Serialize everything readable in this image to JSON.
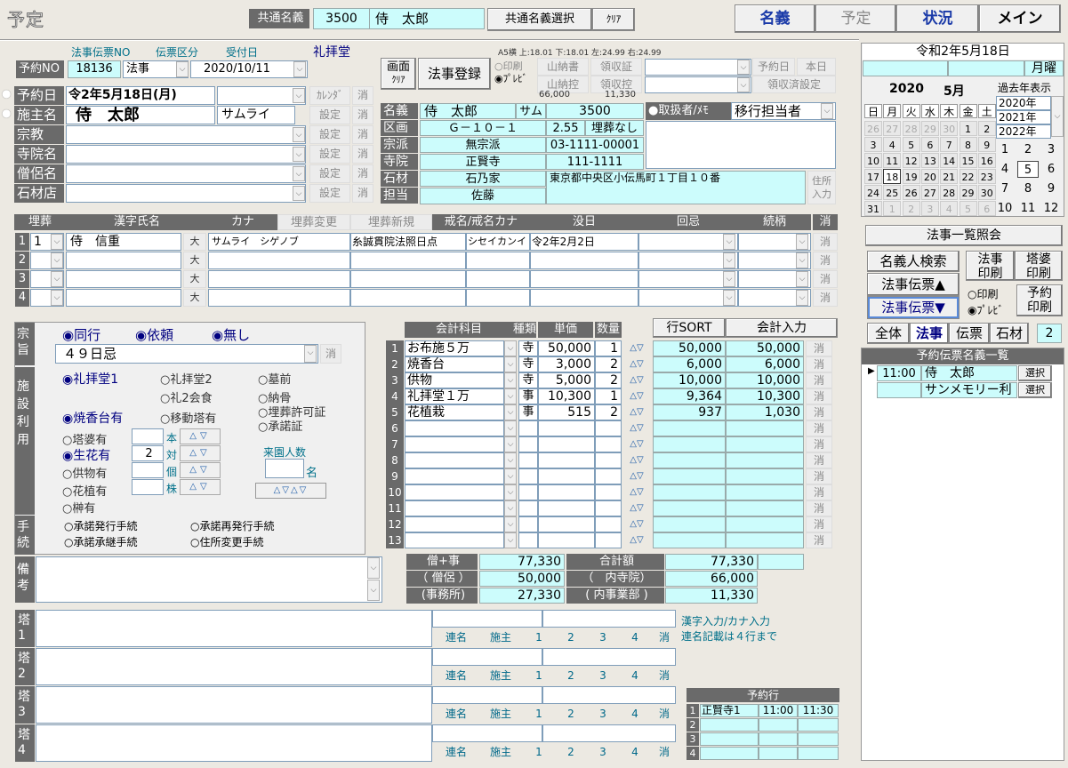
{
  "window": {
    "title": "予定"
  },
  "top": {
    "common_label": "共通名義",
    "common_no": "3500",
    "common_name": "侍　太郎",
    "select_button": "共通名義選択",
    "clear_button": "ｸﾘｱ",
    "tabs": [
      "名義",
      "予定",
      "状況",
      "メイン"
    ]
  },
  "slip": {
    "header_no": "法事伝票NO",
    "header_kubun": "伝票区分",
    "header_date": "受付日",
    "venue": "礼拝堂",
    "label": "予約NO",
    "no": "18136",
    "kubun": "法事",
    "date": "2020/10/11"
  },
  "actions": {
    "screen_clear_1": "画面",
    "screen_clear_2": "ｸﾘｱ",
    "register": "法事登録",
    "print": "印刷",
    "preview": "ﾌﾟﾚﾋﾞ",
    "paper": "A5横 上:18.01 下:18.01 左:24.99 右:24.99",
    "yama_shu": "山納書",
    "yama_hikae": "山納控",
    "ryoshu": "領収証",
    "ryoshu_hikae": "領収控",
    "yoyakubi": "予約日",
    "honjitsu": "本日",
    "ryoshu_settei": "領収済設定",
    "amount_a": "66,000",
    "amount_b": "11,330"
  },
  "form": {
    "rows": [
      {
        "label": "予約日",
        "value": "令2年5月18日(月)",
        "btn": "ｶﾚﾝﾀﾞ"
      },
      {
        "label": "施主名",
        "value": "侍　太郎",
        "kana": "サムライ",
        "btn": "設定"
      },
      {
        "label": "宗教",
        "value": "",
        "btn": "設定"
      },
      {
        "label": "寺院名",
        "value": "",
        "btn": "設定"
      },
      {
        "label": "僧侶名",
        "value": "",
        "btn": "設定"
      },
      {
        "label": "石材店",
        "value": "",
        "btn": "設定"
      }
    ],
    "clear": "消"
  },
  "info": {
    "labels": [
      "名義",
      "区画",
      "宗派",
      "寺院",
      "石材",
      "担当"
    ],
    "name": "侍　太郎",
    "sam": "サム",
    "no": "3500",
    "kukaku": "Ｇ－１０－１",
    "size": "2.55",
    "maiso": "埋葬なし",
    "shuha": "無宗派",
    "phone": "03-1111-00001",
    "jiin": "正賢寺",
    "zip": "111-1111",
    "sekizai": "石乃家",
    "address": "東京都中央区小伝馬町１丁目１０番",
    "tanto": "佐藤",
    "handler": "取扱者/ﾒﾓ",
    "handler_value": "移行担当者",
    "addr_btn_1": "住所",
    "addr_btn_2": "入力"
  },
  "burial": {
    "headers": [
      "埋葬",
      "漢字氏名",
      "カナ",
      "埋葬変更",
      "埋葬新規",
      "戒名/戒名カナ",
      "没日",
      "回忌",
      "続柄",
      "消"
    ],
    "rows": [
      {
        "no": "1",
        "sel": "1",
        "name": "侍　信重",
        "kana": "サムライ　シゲノブ",
        "kaimyo": "糸誠貫院法照日点",
        "kaimyo_kana": "シセイカンイ",
        "botsu": "令2年2月2日"
      },
      {
        "no": "2"
      },
      {
        "no": "3"
      },
      {
        "no": "4"
      }
    ],
    "dai": "大",
    "clear": "消"
  },
  "options": {
    "shushi": "宗旨",
    "shisetsu": "施設利用",
    "tetsuzuki": "手続",
    "doko": "同行",
    "irai": "依頼",
    "nashi": "無し",
    "kaiki": "４９日忌",
    "facilities": [
      "礼拝堂1",
      "礼拝堂2",
      "墓前",
      "礼2会食",
      "納骨",
      "埋葬許可証",
      "承諾証",
      "焼香台有",
      "移動塔有",
      "塔婆有",
      "生花有",
      "供物有",
      "花植有",
      "榊有"
    ],
    "unit_labels": [
      "本",
      "対",
      "個",
      "株"
    ],
    "flower_count": "2",
    "raien": "来園人数",
    "mei": "名",
    "procedures": [
      "承諾発行手続",
      "承諾再発行手続",
      "承諾承継手続",
      "住所変更手続"
    ],
    "biko": "備考"
  },
  "accounts": {
    "headers": [
      "会計科目",
      "種類",
      "単価",
      "数量"
    ],
    "gyo_sort": "行SORT",
    "input": "会計入力",
    "rows": [
      {
        "no": "1",
        "item": "お布施５万",
        "kind": "寺",
        "price": "50,000",
        "qty": "1",
        "a": "50,000",
        "b": "50,000"
      },
      {
        "no": "2",
        "item": "焼香台",
        "kind": "寺",
        "price": "3,000",
        "qty": "2",
        "a": "6,000",
        "b": "6,000"
      },
      {
        "no": "3",
        "item": "供物",
        "kind": "寺",
        "price": "5,000",
        "qty": "2",
        "a": "10,000",
        "b": "10,000"
      },
      {
        "no": "4",
        "item": "礼拝堂１万",
        "kind": "事",
        "price": "10,300",
        "qty": "1",
        "a": "9,364",
        "b": "10,300"
      },
      {
        "no": "5",
        "item": "花植栽",
        "kind": "事",
        "price": "515",
        "qty": "2",
        "a": "937",
        "b": "1,030"
      },
      {
        "no": "6"
      },
      {
        "no": "7"
      },
      {
        "no": "8"
      },
      {
        "no": "9"
      },
      {
        "no": "10"
      },
      {
        "no": "11"
      },
      {
        "no": "12"
      },
      {
        "no": "13"
      }
    ],
    "clear": "消",
    "totals": [
      {
        "label": "僧+事",
        "value": "77,330",
        "label2": "合計額",
        "value2": "77,330"
      },
      {
        "label": "（ 僧侶 ）",
        "value": "50,000",
        "label2": "（　内寺院）",
        "value2": "66,000"
      },
      {
        "label": "(事務所)",
        "value": "27,330",
        "label2": "( 内事業部 )",
        "value2": "11,330"
      }
    ]
  },
  "towers": {
    "labels": [
      "塔1",
      "塔2",
      "塔3",
      "塔4"
    ],
    "buttons": [
      "連名",
      "施主",
      "1",
      "2",
      "3",
      "4",
      "消"
    ],
    "note1": "漢字入力/カナ入力",
    "note2": "連名記載は４行まで"
  },
  "reservation_rows": {
    "title": "予約行",
    "rows": [
      {
        "no": "1",
        "temple": "正賢寺1",
        "start": "11:00",
        "end": "11:30"
      },
      {
        "no": "2"
      },
      {
        "no": "3"
      },
      {
        "no": "4"
      }
    ]
  },
  "calendar": {
    "date": "令和2年5月18日",
    "weekday": "月曜",
    "year": "2020",
    "month": "5月",
    "past": "過去年表示",
    "years": [
      "2020年",
      "2021年",
      "2022年"
    ],
    "weekdays": [
      "日",
      "月",
      "火",
      "水",
      "木",
      "金",
      "土"
    ],
    "days": [
      [
        "26",
        "27",
        "28",
        "29",
        "30",
        "1",
        "2"
      ],
      [
        "3",
        "4",
        "5",
        "6",
        "7",
        "8",
        "9"
      ],
      [
        "10",
        "11",
        "12",
        "13",
        "14",
        "15",
        "16"
      ],
      [
        "17",
        "18",
        "19",
        "20",
        "21",
        "22",
        "23"
      ],
      [
        "24",
        "25",
        "26",
        "27",
        "28",
        "29",
        "30"
      ],
      [
        "31",
        "1",
        "2",
        "3",
        "4",
        "5",
        "6"
      ]
    ],
    "months": [
      "1",
      "2",
      "3",
      "4",
      "5",
      "6",
      "7",
      "8",
      "9",
      "10",
      "11",
      "12"
    ]
  },
  "side": {
    "inquiry": "法事一覧照会",
    "search": "名義人検索",
    "insatsu": "法事印刷",
    "toba": "塔婆印刷",
    "up": "法事伝票▲",
    "down": "法事伝票▼",
    "print": "印刷",
    "preview": "ﾌﾟﾚﾋﾞ",
    "yoyaku_print": "予約印刷",
    "tabs": [
      "全体",
      "法事",
      "伝票",
      "石材"
    ],
    "count": "2",
    "list_title": "予約伝票名義一覧",
    "list": [
      {
        "time": "11:00",
        "name": "侍　太郎",
        "btn": "選択"
      },
      {
        "time": "",
        "name": "サンメモリー利",
        "btn": "選択"
      }
    ]
  }
}
